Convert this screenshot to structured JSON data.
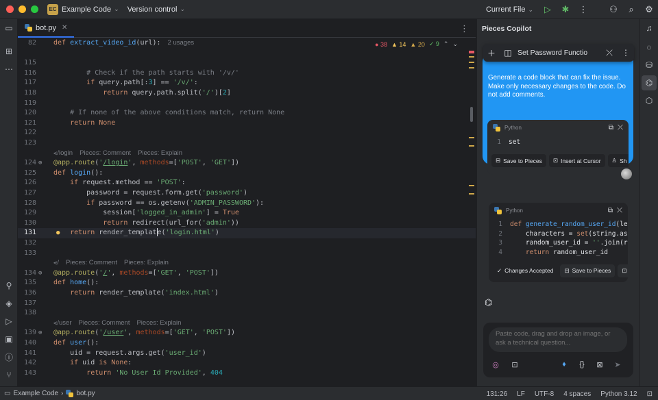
{
  "titlebar": {
    "project_badge": "EC",
    "project_name": "Example Code",
    "vcs": "Version control",
    "run_config": "Current File"
  },
  "editor": {
    "tab": {
      "filename": "bot.py"
    },
    "inspections": {
      "errors": "38",
      "warnings": "14",
      "weak": "20",
      "ok": "9"
    },
    "usages_hint": "2 usages",
    "lines": [
      {
        "n": "82",
        "html": "<span class=\"kw\">def</span> <span class=\"fn\">extract_video_id</span>(url):"
      },
      {
        "n": "115",
        "html": ""
      },
      {
        "n": "116",
        "html": "        <span class=\"cm\"># Check if the path starts with '/v/'</span>"
      },
      {
        "n": "117",
        "html": "        <span class=\"kw\">if</span> query.path[:<span class=\"num\">3</span>] == <span class=\"str\">'/v/'</span>:"
      },
      {
        "n": "118",
        "html": "            <span class=\"kw\">return</span> query.path.split(<span class=\"str\">'/'</span>)[<span class=\"num\">2</span>]"
      },
      {
        "n": "119",
        "html": ""
      },
      {
        "n": "120",
        "html": "    <span class=\"cm\"># If none of the above conditions match, return None</span>"
      },
      {
        "n": "121",
        "html": "    <span class=\"kw\">return None</span>"
      },
      {
        "n": "122",
        "html": ""
      },
      {
        "n": "123",
        "html": ""
      },
      {
        "n": "124",
        "html": "<span class=\"dec\">@app.route</span>(<span class=\"str\">'<u>/login</u>'</span>, <span class=\"prm\">methods</span>=[<span class=\"str\">'POST'</span>, <span class=\"str\">'GET'</span>])"
      },
      {
        "n": "125",
        "html": "<span class=\"kw\">def</span> <span class=\"fn\">login</span>():"
      },
      {
        "n": "126",
        "html": "    <span class=\"kw\">if</span> request.method == <span class=\"str\">'POST'</span>:"
      },
      {
        "n": "127",
        "html": "        password = request.form.get(<span class=\"str\">'password'</span>)"
      },
      {
        "n": "128",
        "html": "        <span class=\"kw\">if</span> password == os.getenv(<span class=\"str\">'ADMIN_PASSWORD'</span>):"
      },
      {
        "n": "129",
        "html": "            session[<span class=\"str\">'logged_in_admin'</span>] = <span class=\"kw\">True</span>"
      },
      {
        "n": "130",
        "html": "            <span class=\"kw\">return</span> redirect(url_for(<span class=\"str\">'admin'</span>))"
      },
      {
        "n": "131",
        "html": "    <span class=\"kw\">return</span> render_templat<span class=\"caret\"></span>e(<span class=\"str\">'login.html'</span>)"
      },
      {
        "n": "132",
        "html": ""
      },
      {
        "n": "133",
        "html": ""
      },
      {
        "n": "134",
        "html": "<span class=\"dec\">@app.route</span>(<span class=\"str\">'<u>/</u>'</span>, <span class=\"prm\">methods</span>=[<span class=\"str\">'GET'</span>, <span class=\"str\">'POST'</span>])"
      },
      {
        "n": "135",
        "html": "<span class=\"kw\">def</span> <span class=\"fn\">home</span>():"
      },
      {
        "n": "136",
        "html": "    <span class=\"kw\">return</span> render_template(<span class=\"str\">'index.html'</span>)"
      },
      {
        "n": "137",
        "html": ""
      },
      {
        "n": "138",
        "html": ""
      },
      {
        "n": "139",
        "html": "<span class=\"dec\">@app.route</span>(<span class=\"str\">'<u>/user</u>'</span>, <span class=\"prm\">methods</span>=[<span class=\"str\">'GET'</span>, <span class=\"str\">'POST'</span>])"
      },
      {
        "n": "140",
        "html": "<span class=\"kw\">def</span> <span class=\"fn\">user</span>():"
      },
      {
        "n": "141",
        "html": "    uid = request.args.get(<span class=\"str\">'user_id'</span>)"
      },
      {
        "n": "142",
        "html": "    <span class=\"kw\">if</span> uid <span class=\"kw\">is None</span>:"
      },
      {
        "n": "143",
        "html": "        <span class=\"kw\">return</span> <span class=\"str\">'No User Id Provided'</span>, <span class=\"num\">404</span>"
      }
    ],
    "inlays": [
      {
        "route": "⪪/login",
        "comment": "Pieces: Comment",
        "explain": "Pieces: Explain"
      },
      {
        "route": "⪪/",
        "comment": "Pieces: Comment",
        "explain": "Pieces: Explain"
      },
      {
        "route": "⪪/user",
        "comment": "Pieces: Comment",
        "explain": "Pieces: Explain"
      }
    ]
  },
  "copilot": {
    "title": "Pieces Copilot",
    "conversation_title": "Set Password Functio",
    "user_message": "Generate a code block that can fix the issue. Make only necessary changes to the code. Do not add comments.",
    "card1": {
      "language": "Python",
      "code": [
        {
          "n": "1",
          "text": "set"
        }
      ],
      "actions": [
        "Save to Pieces",
        "Insert at Cursor",
        "Sh"
      ]
    },
    "card2": {
      "language": "Python",
      "code": [
        {
          "n": "1",
          "html": "<span class=\"kw\">def</span> <span class=\"fn\">generate_random_user_id</span>(le"
        },
        {
          "n": "2",
          "html": "    characters = <span class=\"kw\">set</span>(string.as"
        },
        {
          "n": "3",
          "html": "    random_user_id = <span class=\"str\">''</span>.join(r"
        },
        {
          "n": "4",
          "html": "    <span class=\"kw\">return</span> random_user_id"
        }
      ],
      "actions": [
        "Changes Accepted",
        "Save to Pieces",
        ""
      ]
    },
    "input_placeholder": "Paste code, drag and drop an image, or ask a technical question..."
  },
  "statusbar": {
    "project": "Example Code",
    "file": "bot.py",
    "position": "131:26",
    "line_sep": "LF",
    "encoding": "UTF-8",
    "indent": "4 spaces",
    "interpreter": "Python 3.12"
  },
  "colors": {
    "accent": "#3574f0",
    "bubble": "#2196f3",
    "editor_bg": "#1e1f22",
    "panel_bg": "#2b2d30"
  }
}
